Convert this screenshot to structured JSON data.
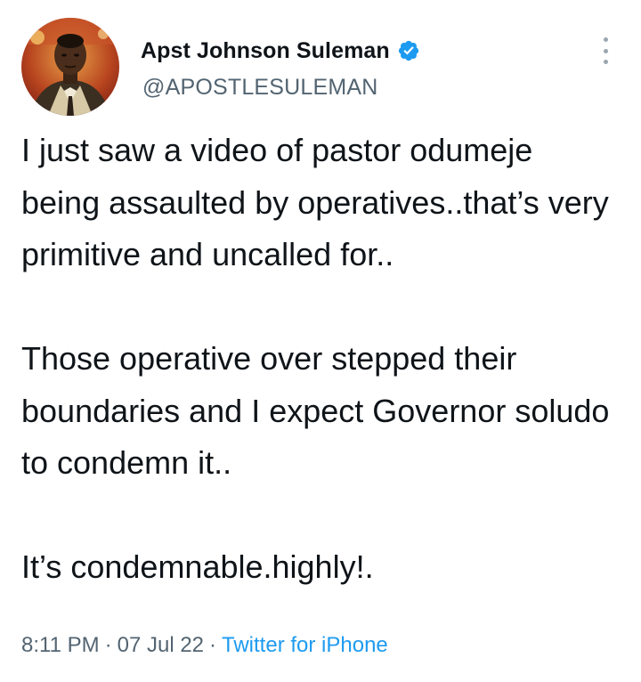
{
  "author": {
    "display_name": "Apst Johnson Suleman",
    "handle": "@APOSTLESULEMAN",
    "verified": true
  },
  "tweet": {
    "paragraphs": [
      "I just saw a video of pastor odumeje being assaulted by operatives..that’s very primitive and uncalled for..",
      "Those operative over stepped their boundaries and I expect Governor soludo to condemn it..",
      "It’s condemnable.highly!."
    ],
    "time": "8:11 PM",
    "date": "07 Jul 22",
    "separator": "·",
    "source": "Twitter for iPhone"
  },
  "icons": {
    "verified": "verified-badge-icon",
    "more": "more-options-icon"
  },
  "colors": {
    "verified_blue": "#1d9bf0",
    "secondary_text": "#536471",
    "primary_text": "#0f1419",
    "link": "#1d9bf0"
  }
}
